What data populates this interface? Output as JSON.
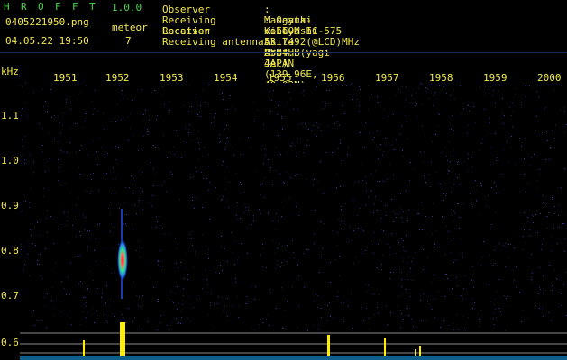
{
  "app": {
    "title_letters": [
      "H",
      "R",
      "O",
      "F",
      "F",
      "T"
    ],
    "version": "1.0.0"
  },
  "file": {
    "name": "0405221950.png",
    "datetime": "04.05.22 19:50"
  },
  "meteor": {
    "label": "meteor",
    "count": "7"
  },
  "info": [
    {
      "key": "Observer",
      "sep": ":",
      "value": "Masayuki Kobayashi"
    },
    {
      "key": "Receiving Location",
      "sep": ":",
      "value": "Ogata-vill. Akita-Pref. JAPAN (139.96E, 40.02N)"
    },
    {
      "key": "Receiver",
      "sep": ":",
      "value": "ICOM IC-575 53.7492(@LCD)MHz USB"
    },
    {
      "key": "Receiving antenna",
      "sep": ":",
      "value": "A504HB(yagi 4el)"
    }
  ],
  "axes": {
    "y_unit": "kHz",
    "x_ticks": [
      "1951",
      "1952",
      "1953",
      "1954",
      "1955",
      "1956",
      "1957",
      "1958",
      "1959",
      "2000"
    ],
    "y_ticks": [
      "1.1",
      "1.0",
      "0.9",
      "0.8",
      "0.7",
      "0.6"
    ]
  },
  "colors": {
    "title": "#4cd64c",
    "text": "#f2e84c",
    "background": "#000000",
    "grid": "#4c6cc8"
  }
}
